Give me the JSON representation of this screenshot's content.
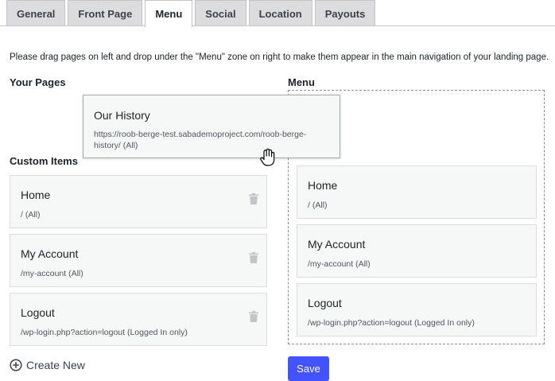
{
  "tabs": [
    {
      "label": "General"
    },
    {
      "label": "Front Page"
    },
    {
      "label": "Menu"
    },
    {
      "label": "Social"
    },
    {
      "label": "Location"
    },
    {
      "label": "Payouts"
    }
  ],
  "active_tab": "Menu",
  "instructions": "Please drag pages on left and drop under the \"Menu\" zone on right to make them appear in the main navigation of your landing page.",
  "your_pages": {
    "title": "Your Pages"
  },
  "dragging_item": {
    "title": "Our History",
    "url": "https://roob-berge-test.sabademoproject.com/roob-berge-history/ (All)"
  },
  "custom_items": {
    "title": "Custom Items",
    "items": [
      {
        "title": "Home",
        "url": "/ (All)"
      },
      {
        "title": "My Account",
        "url": "/my-account (All)"
      },
      {
        "title": "Logout",
        "url": "/wp-login.php?action=logout (Logged In only)"
      }
    ],
    "create_label": "Create New"
  },
  "menu": {
    "title": "Menu",
    "items": [
      {
        "title": "Home",
        "url": "/ (All)"
      },
      {
        "title": "My Account",
        "url": "/my-account (All)"
      },
      {
        "title": "Logout",
        "url": "/wp-login.php?action=logout (Logged In only)"
      }
    ]
  },
  "save_label": "Save",
  "colors": {
    "accent": "#4353ff"
  }
}
